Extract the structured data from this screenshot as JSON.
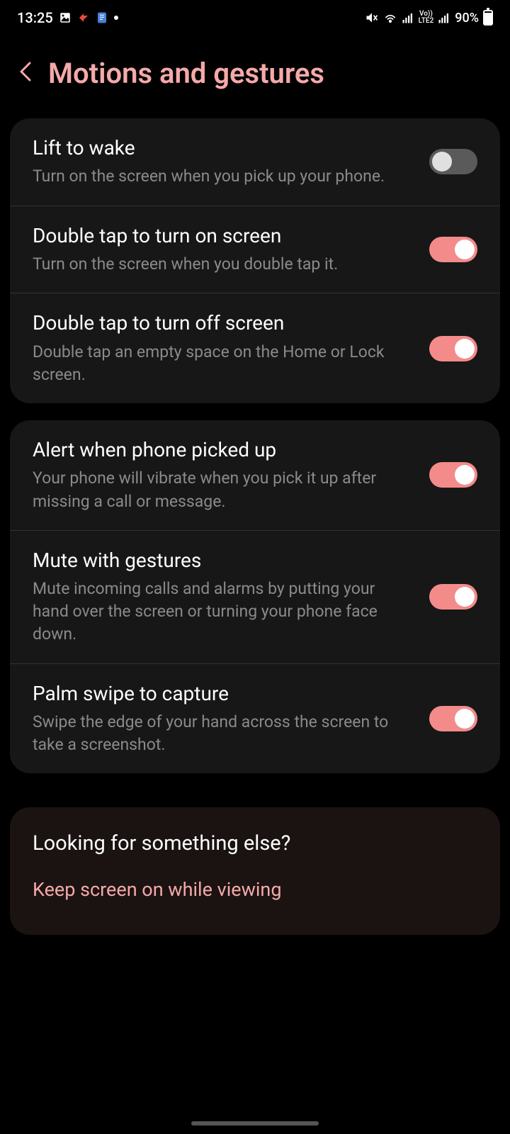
{
  "status_bar": {
    "time": "13:25",
    "battery_percent": "90%",
    "network_label": "LTE2",
    "volte_label": "Vo))"
  },
  "header": {
    "title": "Motions and gestures"
  },
  "groups": [
    {
      "items": [
        {
          "title": "Lift to wake",
          "desc": "Turn on the screen when you pick up your phone.",
          "enabled": false
        },
        {
          "title": "Double tap to turn on screen",
          "desc": "Turn on the screen when you double tap it.",
          "enabled": true
        },
        {
          "title": "Double tap to turn off screen",
          "desc": "Double tap an empty space on the Home or Lock screen.",
          "enabled": true
        }
      ]
    },
    {
      "items": [
        {
          "title": "Alert when phone picked up",
          "desc": "Your phone will vibrate when you pick it up after missing a call or message.",
          "enabled": true
        },
        {
          "title": "Mute with gestures",
          "desc": "Mute incoming calls and alarms by putting your hand over the screen or turning your phone face down.",
          "enabled": true
        },
        {
          "title": "Palm swipe to capture",
          "desc": "Swipe the edge of your hand across the screen to take a screenshot.",
          "enabled": true
        }
      ]
    }
  ],
  "footer": {
    "title": "Looking for something else?",
    "link": "Keep screen on while viewing"
  }
}
